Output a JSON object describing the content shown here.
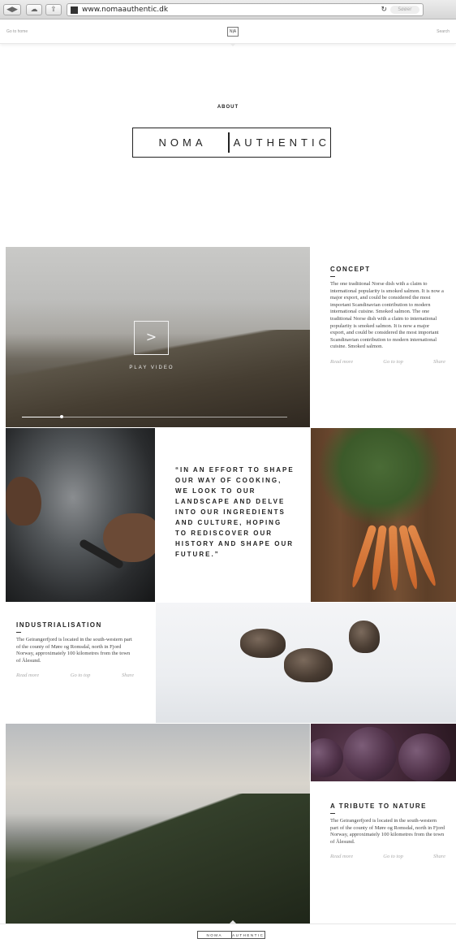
{
  "browser": {
    "back_icon": "chevron-left-icon",
    "forward_icon": "chevron-right-icon",
    "cloud_icon": "cloud-icon",
    "share_icon": "share-icon",
    "url": "www.nomaauthentic.dk",
    "reload_icon": "reload-icon",
    "search_placeholder": "Søøer"
  },
  "topbar": {
    "go_home": "Go to home",
    "search": "Search"
  },
  "hero": {
    "section_label": "ABOUT",
    "logo_left": "NOMA",
    "logo_right": "AUTHENTIC"
  },
  "video": {
    "play_label": "PLAY VIDEO",
    "progress": 0.15
  },
  "concept": {
    "title": "CONCEPT",
    "body": "The one traditional Norse dish with a claim to international popularity is smoked salmon. It is now a major export, and could be considered the most important Scandinavian contribution to modern international cuisine. Smoked salmon. The one traditional Norse dish with a claim to international popularity is smoked salmon. It is now a major export, and could be considered the most important Scandinavian contribution to modern international cuisine. Smoked salmon.",
    "read_more": "Read more",
    "go_to_top": "Go to top",
    "share": "Share"
  },
  "quote": {
    "text": "“IN AN EFFORT TO SHAPE OUR WAY OF COOKING, WE LOOK TO OUR LANDSCAPE AND DELVE INTO OUR INGREDIENTS AND CULTURE, HOPING TO REDISCOVER OUR HISTORY AND SHAPE OUR FUTURE.”"
  },
  "industrialisation": {
    "title": "INDUSTRIALISATION",
    "body": "The Geirangerfjord is located in the south-western part of the county of Møre og Romsdal, north in Fjord Norway, approximately 100 kilometres from the town of Ålesund.",
    "read_more": "Read more",
    "go_to_top": "Go to top",
    "share": "Share"
  },
  "tribute": {
    "title": "A TRIBUTE TO NATURE",
    "body": "The Geirangerfjord is located in the south-western part of the county of Møre og Romsdal, north in Fjord Norway, approximately 100 kilometres from the town of Ålesund.",
    "read_more": "Read more",
    "go_to_top": "Go to top",
    "share": "Share"
  },
  "footer": {
    "logo_left": "NOMA",
    "logo_right": "AUTHENTIC"
  }
}
